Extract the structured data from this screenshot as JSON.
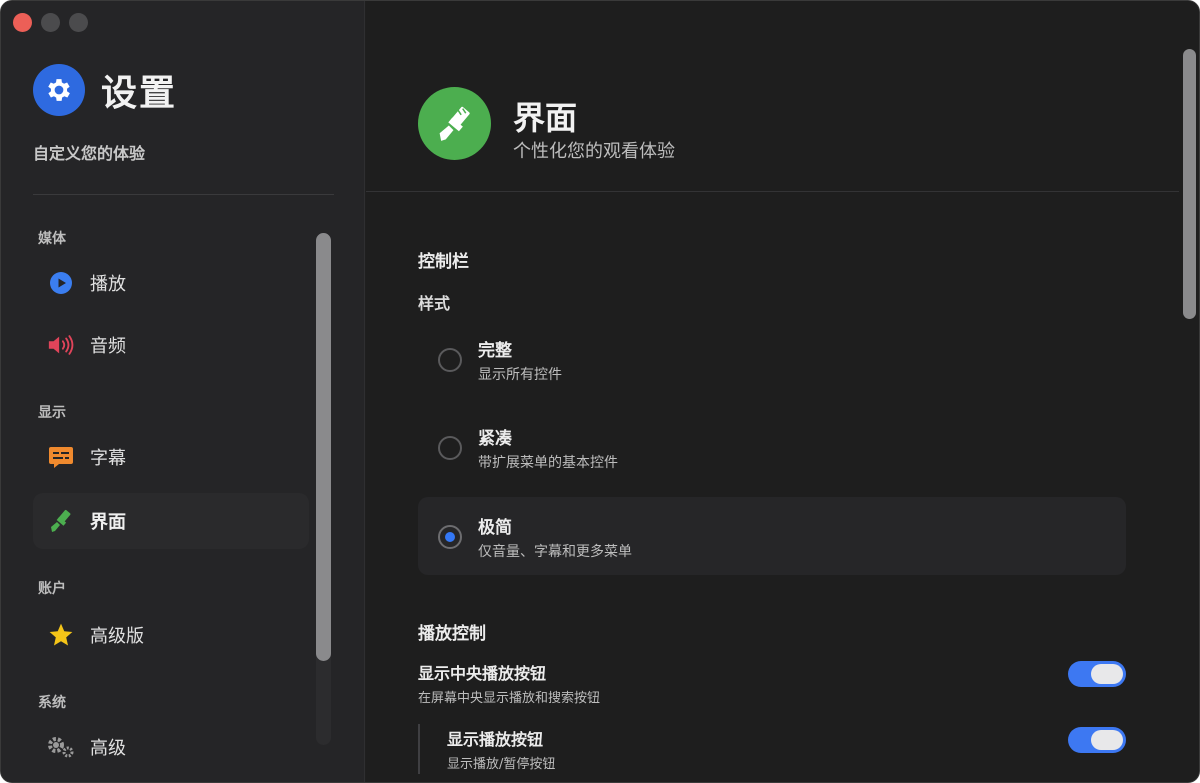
{
  "window": {
    "traffic_lights": [
      "close",
      "minimize",
      "maximize"
    ],
    "colors": {
      "close": "#ec5f57",
      "inactive": "#4b4b4d"
    }
  },
  "sidebar": {
    "title": "设置",
    "subtitle": "自定义您的体验",
    "icon": "gear-icon",
    "sections": [
      {
        "label": "媒体",
        "items": [
          {
            "label": "播放",
            "icon": "play-circle-icon",
            "color": "#3b7ef0"
          },
          {
            "label": "音频",
            "icon": "speaker-icon",
            "color": "#e0445a"
          }
        ]
      },
      {
        "label": "显示",
        "items": [
          {
            "label": "字幕",
            "icon": "subtitles-icon",
            "color": "#f08a2e"
          },
          {
            "label": "界面",
            "icon": "paintbrush-icon",
            "color": "#4cae4f",
            "active": true
          }
        ]
      },
      {
        "label": "账户",
        "items": [
          {
            "label": "高级版",
            "icon": "star-icon",
            "color": "#f5c518"
          }
        ]
      },
      {
        "label": "系统",
        "items": [
          {
            "label": "高级",
            "icon": "gears-icon",
            "color": "#9a9a9a"
          }
        ]
      }
    ]
  },
  "main": {
    "header": {
      "title": "界面",
      "subtitle": "个性化您的观看体验",
      "icon": "paintbrush-icon",
      "color": "#4cae4f"
    },
    "controls_section": {
      "title": "控制栏",
      "style_label": "样式",
      "options": [
        {
          "title": "完整",
          "desc": "显示所有控件",
          "selected": false
        },
        {
          "title": "紧凑",
          "desc": "带扩展菜单的基本控件",
          "selected": false
        },
        {
          "title": "极简",
          "desc": "仅音量、字幕和更多菜单",
          "selected": true
        }
      ]
    },
    "playback_section": {
      "title": "播放控制",
      "toggles": [
        {
          "title": "显示中央播放按钮",
          "desc": "在屏幕中央显示播放和搜索按钮",
          "on": true
        },
        {
          "title": "显示播放按钮",
          "desc": "显示播放/暂停按钮",
          "on": true
        }
      ]
    },
    "accent_color": "#3478f6"
  }
}
